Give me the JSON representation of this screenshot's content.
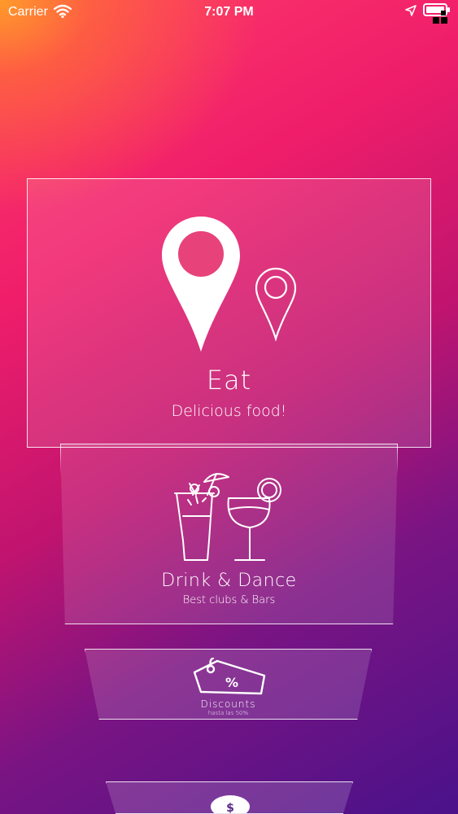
{
  "status_bar": {
    "carrier": "Carrier",
    "time": "7:07 PM",
    "icons": [
      "wifi-icon",
      "location-arrow-icon",
      "battery-icon"
    ]
  },
  "cards": [
    {
      "title": "Eat",
      "subtitle": "Delicious food!",
      "icon": "map-pin-icon"
    },
    {
      "title": "Drink & Dance",
      "subtitle": "Best clubs & Bars",
      "icon": "cocktail-wine-icon"
    },
    {
      "title": "Discounts",
      "subtitle": "hasta las 50%",
      "icon": "discount-tag-icon"
    },
    {
      "title": "",
      "subtitle": "",
      "icon": "next-card-icon"
    }
  ],
  "colors": {
    "gradient_top_left": "#ff9a2a",
    "gradient_mid": "#f01e6a",
    "gradient_bottom_right": "#4a128a"
  }
}
